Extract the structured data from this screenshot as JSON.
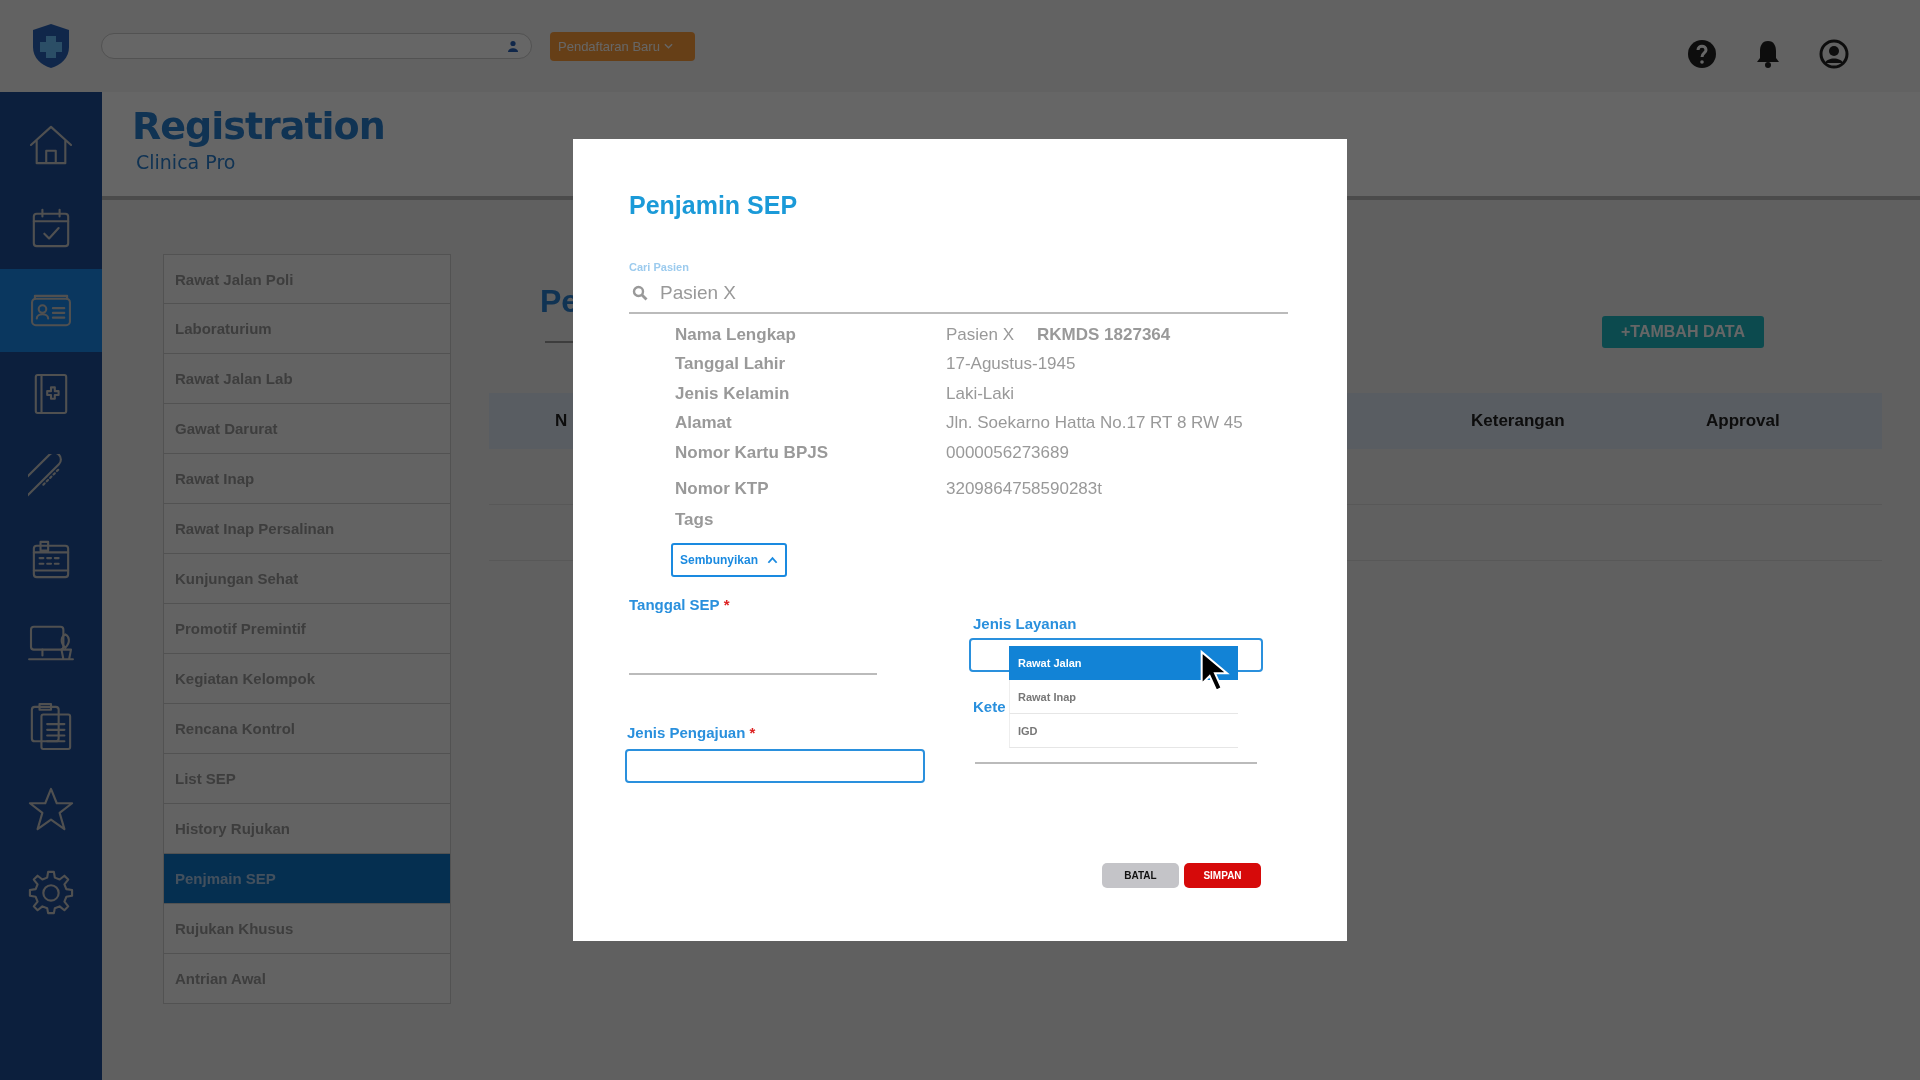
{
  "top_bar": {
    "new_button": "Pendaftaran Baru"
  },
  "header": {
    "title": "Registration",
    "subtitle": "Clinica Pro"
  },
  "nav": [
    {
      "selected": false
    },
    {
      "selected": false
    },
    {
      "selected": true
    },
    {
      "selected": false
    },
    {
      "selected": false
    },
    {
      "selected": false
    },
    {
      "selected": false
    },
    {
      "selected": false
    },
    {
      "selected": false
    },
    {
      "selected": false
    }
  ],
  "menu": [
    {
      "label": "Rawat Jalan Poli",
      "selected": false
    },
    {
      "label": "Laboraturium",
      "selected": false
    },
    {
      "label": "Rawat Jalan Lab",
      "selected": false
    },
    {
      "label": "Gawat Darurat",
      "selected": false
    },
    {
      "label": "Rawat Inap",
      "selected": false
    },
    {
      "label": "Rawat Inap Persalinan",
      "selected": false
    },
    {
      "label": "Kunjungan Sehat",
      "selected": false
    },
    {
      "label": "Promotif Premintif",
      "selected": false
    },
    {
      "label": "Kegiatan Kelompok",
      "selected": false
    },
    {
      "label": "Rencana Kontrol",
      "selected": false
    },
    {
      "label": "List SEP",
      "selected": false
    },
    {
      "label": "History Rujukan",
      "selected": false
    },
    {
      "label": "Penjmain SEP",
      "selected": true
    },
    {
      "label": "Rujukan Khusus",
      "selected": false
    },
    {
      "label": "Antrian Awal",
      "selected": false
    }
  ],
  "page": {
    "title": "Pe",
    "add_button": "+TAMBAH DATA",
    "columns": [
      "N",
      "Keterangan",
      "Approval"
    ]
  },
  "modal": {
    "title": "Penjamin SEP",
    "search": {
      "label": "Cari Pasien",
      "value": "Pasien X"
    },
    "details": [
      {
        "label": "Nama Lengkap",
        "value": "Pasien X",
        "code": "RKMDS 1827364"
      },
      {
        "label": "Tanggal Lahir",
        "value": "17-Agustus-1945"
      },
      {
        "label": "Jenis Kelamin",
        "value": "Laki-Laki"
      },
      {
        "label": "Alamat",
        "value": "Jln. Soekarno Hatta No.17 RT 8 RW 45"
      },
      {
        "label": "Nomor Kartu BPJS",
        "value": "0000056273689"
      },
      {
        "label": "Nomor KTP",
        "value": "3209864758590283t"
      },
      {
        "label": "Tags"
      }
    ],
    "toggle_button": "Sembunyikan",
    "left_fields": [
      {
        "label": "Tanggal SEP",
        "required_mark": "*",
        "kind": "line"
      },
      {
        "label": "Jenis Pengajuan",
        "required_mark": "*",
        "kind": "box"
      }
    ],
    "right_fields": [
      {
        "label": "Jenis Layanan",
        "kind": "select",
        "options": [
          {
            "label": "Rawat Jalan",
            "selected": true
          },
          {
            "label": "Rawat Inap",
            "selected": false
          },
          {
            "label": "IGD",
            "selected": false
          }
        ]
      },
      {
        "label": "Kete",
        "kind": "line"
      }
    ],
    "buttons": [
      {
        "label": "BATAL",
        "kind": "cancel"
      },
      {
        "label": "SIMPAN",
        "kind": "primary"
      }
    ]
  }
}
